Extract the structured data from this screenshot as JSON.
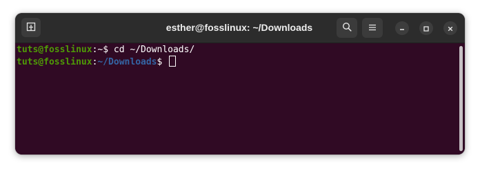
{
  "window": {
    "title": "esther@fosslinux: ~/Downloads"
  },
  "titlebar_icons": {
    "new_tab": "new-tab-icon",
    "search": "search-icon",
    "menu": "hamburger-menu-icon",
    "minimize": "minimize-icon",
    "maximize": "maximize-icon",
    "close": "close-icon"
  },
  "terminal": {
    "lines": [
      {
        "user_host": "tuts@fosslinux",
        "separator": ":",
        "path": "~",
        "prompt": "$ ",
        "command": "cd ~/Downloads/"
      },
      {
        "user_host": "tuts@fosslinux",
        "separator": ":",
        "path": "~/Downloads",
        "prompt": "$ ",
        "command": ""
      }
    ]
  },
  "colors": {
    "terminal_background": "#300a24",
    "titlebar_background": "#2c2c2c",
    "prompt_user": "#4e9a06",
    "prompt_path": "#3465a4",
    "text": "#ffffff"
  }
}
